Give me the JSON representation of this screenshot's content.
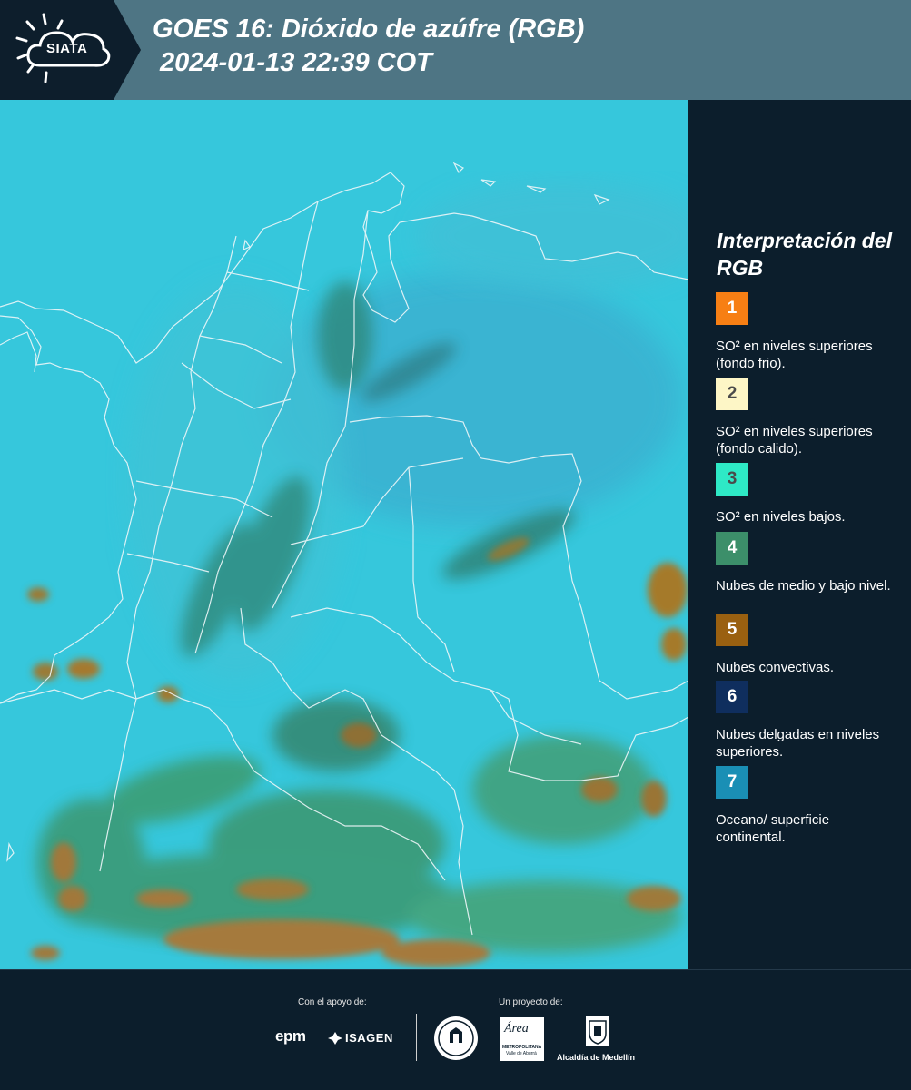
{
  "header": {
    "logo_text": "SIATA",
    "title_line1": "GOES 16: Dióxido de azúfre (RGB)",
    "title_line2": "2024-01-13 22:39 COT",
    "background_color": "#4e7584",
    "logo_panel_color": "#0d1e2c"
  },
  "legend": {
    "title": "Interpretación del RGB",
    "items": [
      {
        "number": "1",
        "color": "#f77f14",
        "label": "SO² en niveles superiores (fondo frio)."
      },
      {
        "number": "2",
        "color": "#fdf6c6",
        "label": "SO² en niveles superiores (fondo calido)."
      },
      {
        "number": "3",
        "color": "#2ee9c6",
        "label": "SO² en niveles bajos."
      },
      {
        "number": "4",
        "color": "#3c8f6a",
        "label": "Nubes de medio y bajo nivel."
      },
      {
        "number": "5",
        "color": "#9a6010",
        "label": "Nubes convectivas."
      },
      {
        "number": "6",
        "color": "#0f2e5e",
        "label": "Nubes delgadas en niveles superiores."
      },
      {
        "number": "7",
        "color": "#1a8fb5",
        "label": "Oceano/ superficie continental."
      }
    ]
  },
  "map": {
    "background_color": "#36c7dc"
  },
  "footer": {
    "support_label": "Con el apoyo de:",
    "project_label": "Un proyecto de:",
    "sponsor_epm": "epm",
    "sponsor_isagen": "ISAGEN",
    "metro_area_name": "Área",
    "metro_area_sub": "METROPOLITANA",
    "metro_area_sub2": "Valle de Aburrá",
    "alcaldia": "Alcaldía de Medellín"
  }
}
